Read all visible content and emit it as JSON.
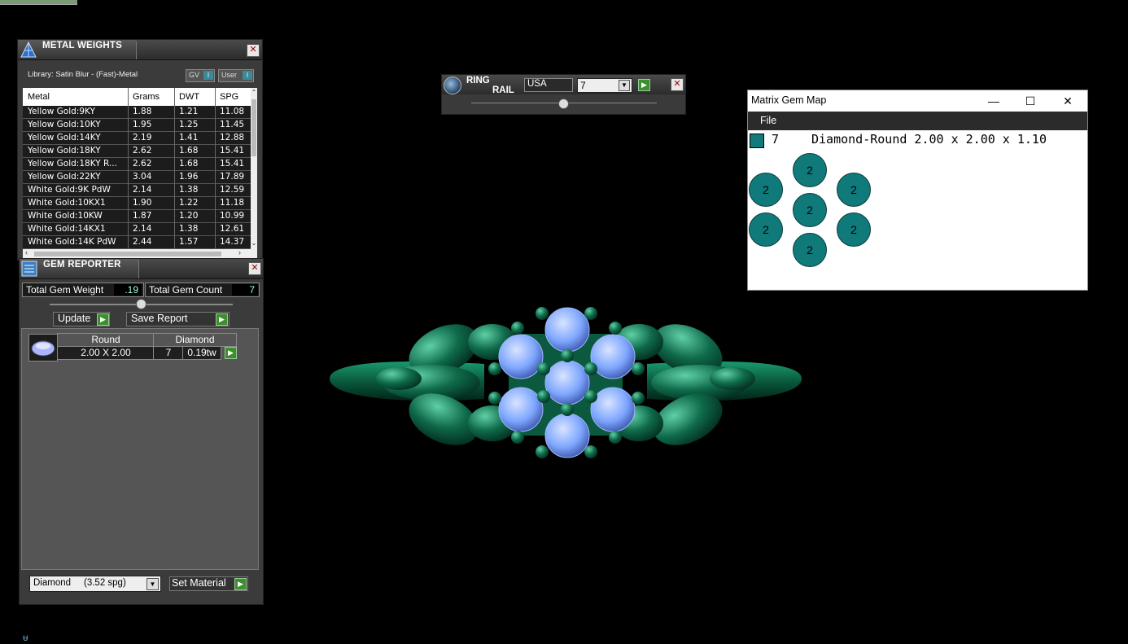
{
  "metal_weights": {
    "title": "METAL WEIGHTS",
    "library": "Library: Satin Blur - (Fast)-Metal",
    "gv_label": "GV",
    "user_label": "User",
    "columns": [
      "Metal",
      "Grams",
      "DWT",
      "SPG"
    ],
    "rows": [
      [
        "Yellow Gold:9KY",
        "1.88",
        "1.21",
        "11.08"
      ],
      [
        "Yellow Gold:10KY",
        "1.95",
        "1.25",
        "11.45"
      ],
      [
        "Yellow Gold:14KY",
        "2.19",
        "1.41",
        "12.88"
      ],
      [
        "Yellow Gold:18KY",
        "2.62",
        "1.68",
        "15.41"
      ],
      [
        "Yellow Gold:18KY R...",
        "2.62",
        "1.68",
        "15.41"
      ],
      [
        "Yellow Gold:22KY",
        "3.04",
        "1.96",
        "17.89"
      ],
      [
        "White Gold:9K PdW",
        "2.14",
        "1.38",
        "12.59"
      ],
      [
        "White Gold:10KX1",
        "1.90",
        "1.22",
        "11.18"
      ],
      [
        "White Gold:10KW",
        "1.87",
        "1.20",
        "10.99"
      ],
      [
        "White Gold:14KX1",
        "2.14",
        "1.38",
        "12.61"
      ],
      [
        "White Gold:14K PdW",
        "2.44",
        "1.57",
        "14.37"
      ]
    ]
  },
  "gem_reporter": {
    "title": "GEM REPORTER",
    "total_weight_label": "Total Gem Weight",
    "total_weight_value": ".19",
    "total_count_label": "Total Gem Count",
    "total_count_value": "7",
    "update_label": "Update",
    "save_report_label": "Save Report",
    "gems": [
      {
        "shape": "Round",
        "material": "Diamond",
        "size": "2.00 X 2.00",
        "count": "7",
        "weight": "0.19tw"
      }
    ],
    "material_select": "Diamond     (3.52 spg)",
    "set_material_label": "Set Material"
  },
  "ring_rail": {
    "title_line1": "RING",
    "title_line2": "RAIL",
    "region": "USA",
    "size": "7"
  },
  "matrix_gem_map": {
    "title": "Matrix Gem Map",
    "menu": [
      "File"
    ],
    "gem_count": "7",
    "gem_description": "Diamond-Round 2.00 x 2.00 x 1.10",
    "swatch_color": "#137a7a",
    "gem_labels": [
      "2",
      "2",
      "2",
      "2",
      "2",
      "2",
      "2"
    ]
  },
  "colors": {
    "panel_bg": "#3b3b3b",
    "metal_green": "#0f6a4a",
    "gem_blue": "#7ea6ff",
    "accent_go": "#3c8f2c"
  }
}
